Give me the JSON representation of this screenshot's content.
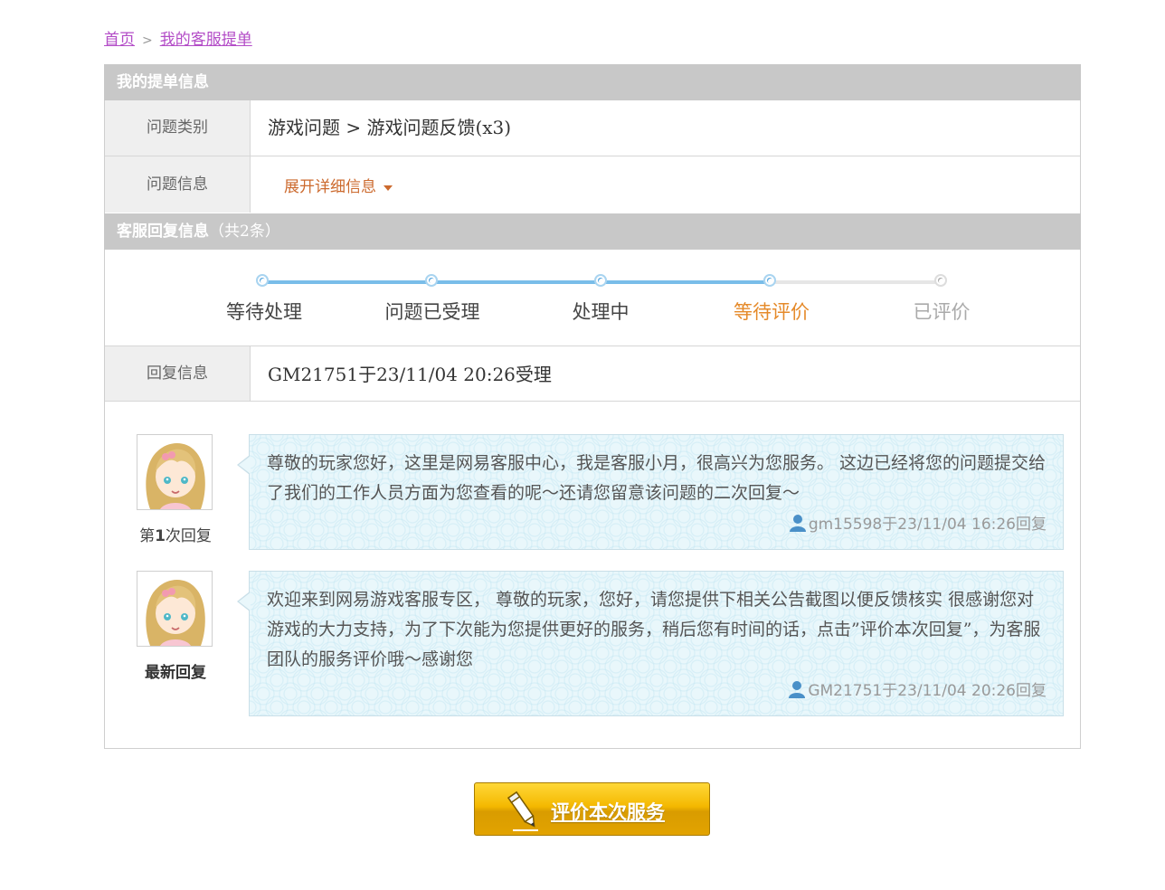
{
  "breadcrumb": {
    "home": "首页",
    "separator": ">",
    "current": "我的客服提单"
  },
  "ticket_section": {
    "title": "我的提单信息"
  },
  "category": {
    "label": "问题类别",
    "value": "游戏问题 > 游戏问题反馈(x3)"
  },
  "issue_info": {
    "label": "问题信息",
    "expand": "展开详细信息"
  },
  "reply_section": {
    "title": "客服回复信息",
    "count": "（共2条）"
  },
  "progress": {
    "steps": [
      {
        "label": "等待处理",
        "state": "done"
      },
      {
        "label": "问题已受理",
        "state": "done"
      },
      {
        "label": "处理中",
        "state": "done"
      },
      {
        "label": "等待评价",
        "state": "current"
      },
      {
        "label": "已评价",
        "state": "pending"
      }
    ],
    "colors": {
      "done": "#5aa9e0",
      "current": "#e58a2a",
      "pending": "#aaaaaa",
      "done_text": "#444444"
    }
  },
  "reply_info": {
    "label": "回复信息",
    "value": "GM21751于23/11/04 20:26受理"
  },
  "replies": [
    {
      "caption_prefix": "第",
      "caption_num": "1",
      "caption_suffix": "次回复",
      "text": "尊敬的玩家您好，这里是网易客服中心，我是客服小月，很高兴为您服务。 这边已经将您的问题提交给了我们的工作人员方面为您查看的呢～还请您留意该问题的二次回复～",
      "author": "gm15598",
      "yu": "于",
      "time": "23/11/04 16:26",
      "hui": "回复"
    },
    {
      "caption": "最新回复",
      "text": "欢迎来到网易游戏客服专区， 尊敬的玩家，您好，请您提供下相关公告截图以便反馈核实 很感谢您对游戏的大力支持，为了下次能为您提供更好的服务，稍后您有时间的话，点击”评价本次回复”，为客服团队的服务评价哦～感谢您",
      "author": "GM21751",
      "yu": "于",
      "time": "23/11/04 20:26",
      "hui": "回复"
    }
  ],
  "rate_button": {
    "label": "评价本次服务"
  },
  "colors": {
    "link": "#b34cc7",
    "header_bg": "#c8c8c8",
    "button_gold": "#f4b800"
  }
}
